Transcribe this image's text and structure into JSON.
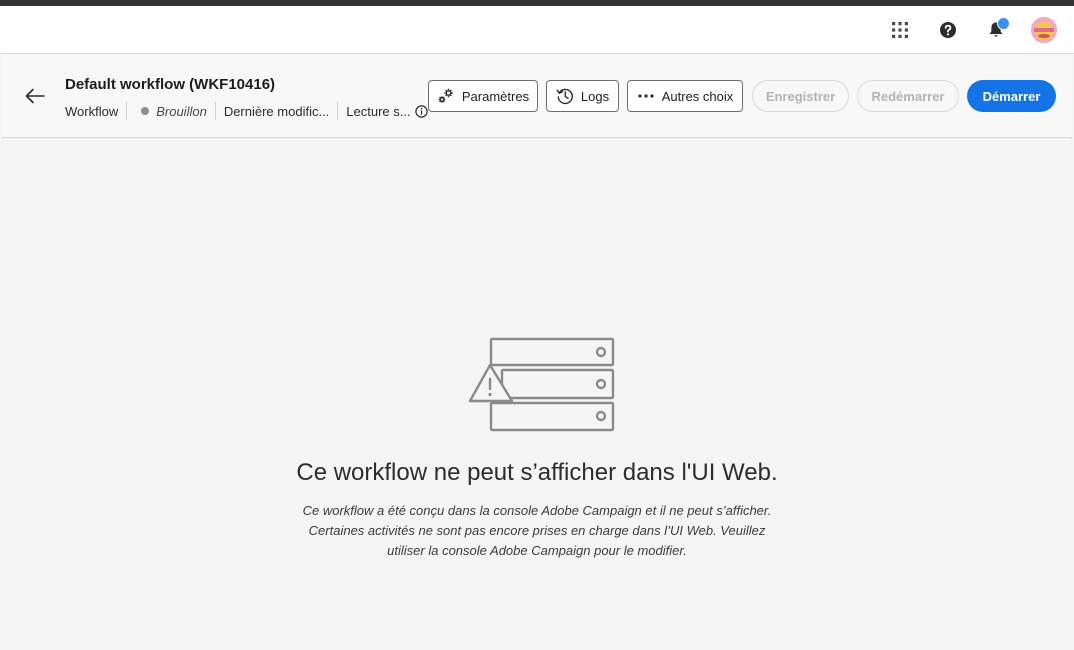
{
  "shell": {
    "icons": [
      "apps-grid-icon",
      "help-icon",
      "bell-icon",
      "user-avatar"
    ],
    "notification_color": "#3b8ff0"
  },
  "header": {
    "title": "Default workflow (WKF10416)",
    "meta": {
      "type": "Workflow",
      "status": "Brouillon",
      "last_modified": "Dernière modific...",
      "read": "Lecture s..."
    }
  },
  "toolbar": {
    "settings_label": "Paramètres",
    "logs_label": "Logs",
    "more_label": "Autres choix",
    "save_label": "Enregistrer",
    "restart_label": "Redémarrer",
    "start_label": "Démarrer"
  },
  "empty_state": {
    "title": "Ce workflow ne peut s’afficher dans l'UI Web.",
    "line1": "Ce workflow a été conçu dans la console Adobe Campaign et il ne peut s’afficher.",
    "line2": "Certaines activités ne sont pas encore prises en charge dans l’UI Web. Veuillez",
    "line3": "utiliser la console Adobe Campaign pour le modifier."
  },
  "colors": {
    "primary": "#1473e6",
    "disabled_text": "#b3b3b3",
    "status_dot": "#8e8e8e"
  }
}
